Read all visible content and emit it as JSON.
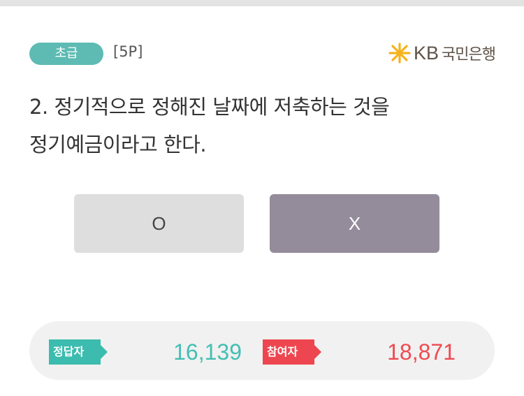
{
  "quiz": {
    "level_badge": "초급",
    "points": "[5P]",
    "question_line1": "2. 정기적으로 정해진 날짜에 저축하는 것을",
    "question_line2": "정기예금이라고 한다."
  },
  "brand": {
    "logo_mark": "KB",
    "name": "국민은행",
    "icon": "kb-star-icon",
    "colors": {
      "star": "#f5b21b",
      "text": "#5e5247"
    }
  },
  "answers": {
    "o_label": "O",
    "x_label": "X",
    "selected": "X"
  },
  "stats": {
    "correct_label": "정답자",
    "correct_count": "16,139",
    "participants_label": "참여자",
    "participants_count": "18,871"
  },
  "colors": {
    "teal": "#3bbcae",
    "red": "#ee4650",
    "selected_button": "#958c9b",
    "unselected_button": "#dedede"
  }
}
